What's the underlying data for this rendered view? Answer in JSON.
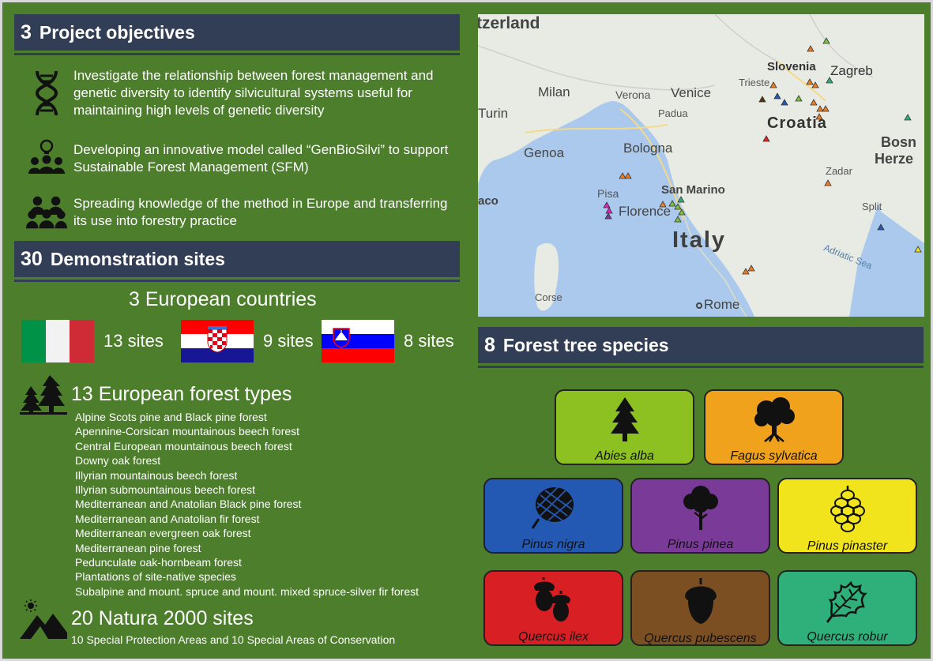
{
  "objectives": {
    "number": "3",
    "title": "Project objectives",
    "items": [
      {
        "icon": "dna-icon",
        "text": "Investigate the relationship between forest management and genetic diversity to identify silvicultural systems useful for maintaining high levels of genetic diversity"
      },
      {
        "icon": "team-idea-icon",
        "text": "Developing an innovative model called “GenBioSilvi” to support Sustainable Forest Management (SFM)"
      },
      {
        "icon": "audience-icon",
        "text": "Spreading knowledge of the method in Europe and transferring its use into forestry practice"
      }
    ]
  },
  "demo": {
    "number": "30",
    "title": "Demonstration sites",
    "countries_count": "3",
    "countries_label": "European countries",
    "countries": [
      {
        "name": "Italy",
        "sites": "13 sites",
        "colors": [
          "#009246",
          "#f1f2f1",
          "#ce2b37"
        ]
      },
      {
        "name": "Croatia",
        "sites": "9 sites",
        "colors": [
          "#ff0000",
          "#ffffff",
          "#171796"
        ]
      },
      {
        "name": "Slovenia",
        "sites": "8 sites",
        "colors": [
          "#ffffff",
          "#0000ff",
          "#ff0000"
        ]
      }
    ],
    "forest_types_count": "13",
    "forest_types_label": "European forest types",
    "forest_types": [
      "Alpine Scots pine and Black pine forest",
      "Apennine-Corsican mountainous beech forest",
      "Central European mountainous beech forest",
      "Downy oak forest",
      "Illyrian mountainous beech forest",
      "Illyrian submountainous beech forest",
      "Mediterranean and Anatolian Black pine forest",
      "Mediterranean and Anatolian fir forest",
      "Mediterranean evergreen oak forest",
      "Mediterranean pine forest",
      "Pedunculate oak-hornbeam forest",
      "Plantations of site-native species",
      "Subalpine and mount. spruce and mount. mixed spruce-silver fir forest"
    ],
    "natura_count": "20",
    "natura_label": "Natura 2000 sites",
    "natura_detail": "10 Special Protection Areas and 10 Special Areas of Conservation"
  },
  "map": {
    "labels": {
      "switzerland": "tzerland",
      "slovenia": "Slovenia",
      "zagreb": "Zagreb",
      "trieste": "Trieste",
      "milan": "Milan",
      "verona": "Verona",
      "venice": "Venice",
      "padua": "Padua",
      "turin": "Turin",
      "croatia": "Croatia",
      "bosnia1": "Bosn",
      "bosnia2": "Herze",
      "genoa": "Genoa",
      "bologna": "Bologna",
      "zadar": "Zadar",
      "san_marino": "San Marino",
      "pisa": "Pisa",
      "monaco": "aco",
      "florence": "Florence",
      "split": "Split",
      "italy": "Italy",
      "adriatic": "Adriatic Sea",
      "corse": "Corse",
      "rome": "Rome"
    }
  },
  "species": {
    "number": "8",
    "title": "Forest tree species",
    "items": [
      {
        "name": "Abies alba",
        "icon": "fir-tree-icon",
        "color": "#8dc021"
      },
      {
        "name": "Fagus sylvatica",
        "icon": "beech-tree-icon",
        "color": "#f0a21c"
      },
      {
        "name": "Pinus nigra",
        "icon": "pine-cone-icon",
        "color": "#2459b3"
      },
      {
        "name": "Pinus pinea",
        "icon": "umbrella-pine-icon",
        "color": "#7a3b98"
      },
      {
        "name": "Pinus pinaster",
        "icon": "pinaster-cone-icon",
        "color": "#f2e41c"
      },
      {
        "name": "Quercus ilex",
        "icon": "acorn-ilex-icon",
        "color": "#d82024"
      },
      {
        "name": "Quercus pubescens",
        "icon": "acorn-icon",
        "color": "#7b4f22"
      },
      {
        "name": "Quercus robur",
        "icon": "oak-leaf-icon",
        "color": "#2fb07b"
      }
    ]
  }
}
